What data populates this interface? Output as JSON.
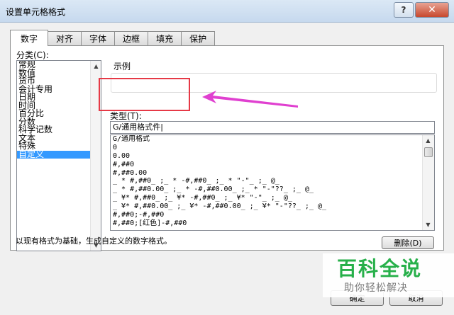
{
  "window": {
    "title": "设置单元格格式",
    "help_label": "?",
    "close_label": "✕"
  },
  "tabs": [
    {
      "label": "数字",
      "active": true
    },
    {
      "label": "对齐"
    },
    {
      "label": "字体"
    },
    {
      "label": "边框"
    },
    {
      "label": "填充"
    },
    {
      "label": "保护"
    }
  ],
  "category": {
    "label": "分类(C):",
    "items": [
      "常规",
      "数值",
      "货币",
      "会计专用",
      "日期",
      "时间",
      "百分比",
      "分数",
      "科学记数",
      "文本",
      "特殊",
      "自定义"
    ],
    "selected": "自定义"
  },
  "sample": {
    "label": "示例"
  },
  "type": {
    "label": "类型(T):",
    "value": "G/通用格式件|"
  },
  "formats": [
    "G/通用格式",
    "0",
    "0.00",
    "#,##0",
    "#,##0.00",
    "_ * #,##0_ ;_ * -#,##0_ ;_ * \"-\"_ ;_ @_",
    "_ * #,##0.00_ ;_ * -#,##0.00_ ;_ * \"-\"??_ ;_ @_",
    "_ ¥* #,##0_ ;_ ¥* -#,##0_ ;_ ¥* \"-\"_ ;_ @_",
    "_ ¥* #,##0.00_ ;_ ¥* -#,##0.00_ ;_ ¥* \"-\"??_ ;_ @_",
    "#,##0;-#,##0",
    "#,##0;[红色]-#,##0"
  ],
  "delete_label": "删除(D)",
  "description": "以现有格式为基础，生成自定义的数字格式。",
  "ok_label": "确定",
  "cancel_label": "取消",
  "watermark": {
    "main": "百科全说",
    "sub": "助你轻松解决"
  },
  "colors": {
    "highlight": "#e63946",
    "arrow": "#e040d0",
    "selection": "#3399ff",
    "watermark_green": "#27b04a"
  }
}
